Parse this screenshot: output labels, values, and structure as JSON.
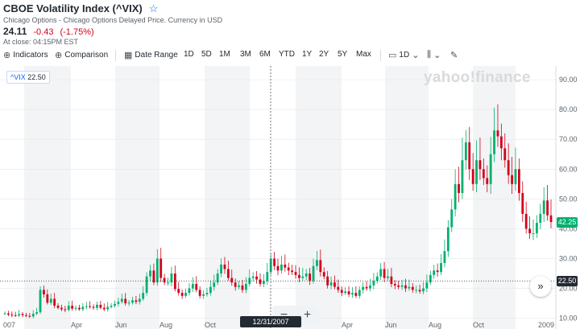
{
  "header": {
    "title": "CBOE Volatility Index (^VIX)",
    "source": "Chicago Options - Chicago Options Delayed Price. Currency in USD",
    "price": "24.11",
    "change": "-0.43",
    "change_pct": "(-1.75%)",
    "close_time": "At close: 04:15PM EST"
  },
  "toolbar": {
    "indicators": "Indicators",
    "comparison": "Comparison",
    "date_range": "Date Range",
    "ranges": [
      "1D",
      "5D",
      "1M",
      "3M",
      "6M",
      "YTD",
      "1Y",
      "2Y",
      "5Y",
      "Max"
    ],
    "interval": "1D"
  },
  "logo_text": "yahoo!finance",
  "chart_data": {
    "type": "candlestick",
    "symbol_tag": {
      "symbol": "^VIX",
      "value": "22.50"
    },
    "y_ticks": [
      "90.00",
      "80.00",
      "70.00",
      "60.00",
      "50.00",
      "40.00",
      "30.00",
      "20.00",
      "10.00"
    ],
    "x_ticks": [
      "007",
      "Apr",
      "Jun",
      "Aug",
      "Oct",
      "Apr",
      "Jun",
      "Aug",
      "Oct",
      "2009"
    ],
    "ylim": [
      8,
      93
    ],
    "last_price": "42.25",
    "reference_price": "22.50",
    "crosshair_date": "12/31/2007",
    "colors": {
      "up": "#00b06e",
      "down": "#d0021b",
      "last": "#00b06e",
      "ref": "#232a31"
    },
    "series_close": [
      11.6,
      11.2,
      11.0,
      10.9,
      11.4,
      11.0,
      10.8,
      10.6,
      11.5,
      12.0,
      19.5,
      18.0,
      15.2,
      16.5,
      14.2,
      13.5,
      13.0,
      12.8,
      14.2,
      13.2,
      13.5,
      13.0,
      13.8,
      14.0,
      13.8,
      13.5,
      14.5,
      13.5,
      13.0,
      13.8,
      14.2,
      14.8,
      15.5,
      16.5,
      15.0,
      15.2,
      16.0,
      15.5,
      16.5,
      18.5,
      24.0,
      26.0,
      22.0,
      30.0,
      23.5,
      22.0,
      22.0,
      25.0,
      19.8,
      18.5,
      17.5,
      18.5,
      20.0,
      21.5,
      19.5,
      17.5,
      18.0,
      18.5,
      20.5,
      22.0,
      25.0,
      28.0,
      26.5,
      23.5,
      22.0,
      20.5,
      21.0,
      19.5,
      21.5,
      23.5,
      24.0,
      23.0,
      21.5,
      22.5,
      25.5,
      30.0,
      27.5,
      26.0,
      28.0,
      27.0,
      26.0,
      25.5,
      24.5,
      23.5,
      24.0,
      25.0,
      22.5,
      27.5,
      29.5,
      25.5,
      24.0,
      21.0,
      22.0,
      20.5,
      19.5,
      18.5,
      19.0,
      18.0,
      18.5,
      17.5,
      19.5,
      20.5,
      20.0,
      21.0,
      22.5,
      24.0,
      26.5,
      23.5,
      24.0,
      21.5,
      21.0,
      20.5,
      21.0,
      20.0,
      20.5,
      19.5,
      19.5,
      19.0,
      20.0,
      22.0,
      24.5,
      26.0,
      25.5,
      28.5,
      32.5,
      40.5,
      46.5,
      55.0,
      52.0,
      63.0,
      69.0,
      60.0,
      55.0,
      63.0,
      60.0,
      57.0,
      55.0,
      65.0,
      73.0,
      71.0,
      67.0,
      63.0,
      58.0,
      55.0,
      60.0,
      52.0,
      45.0,
      40.0,
      38.5,
      38.5,
      42.0,
      45.0,
      49.5,
      44.5,
      42.25
    ]
  }
}
